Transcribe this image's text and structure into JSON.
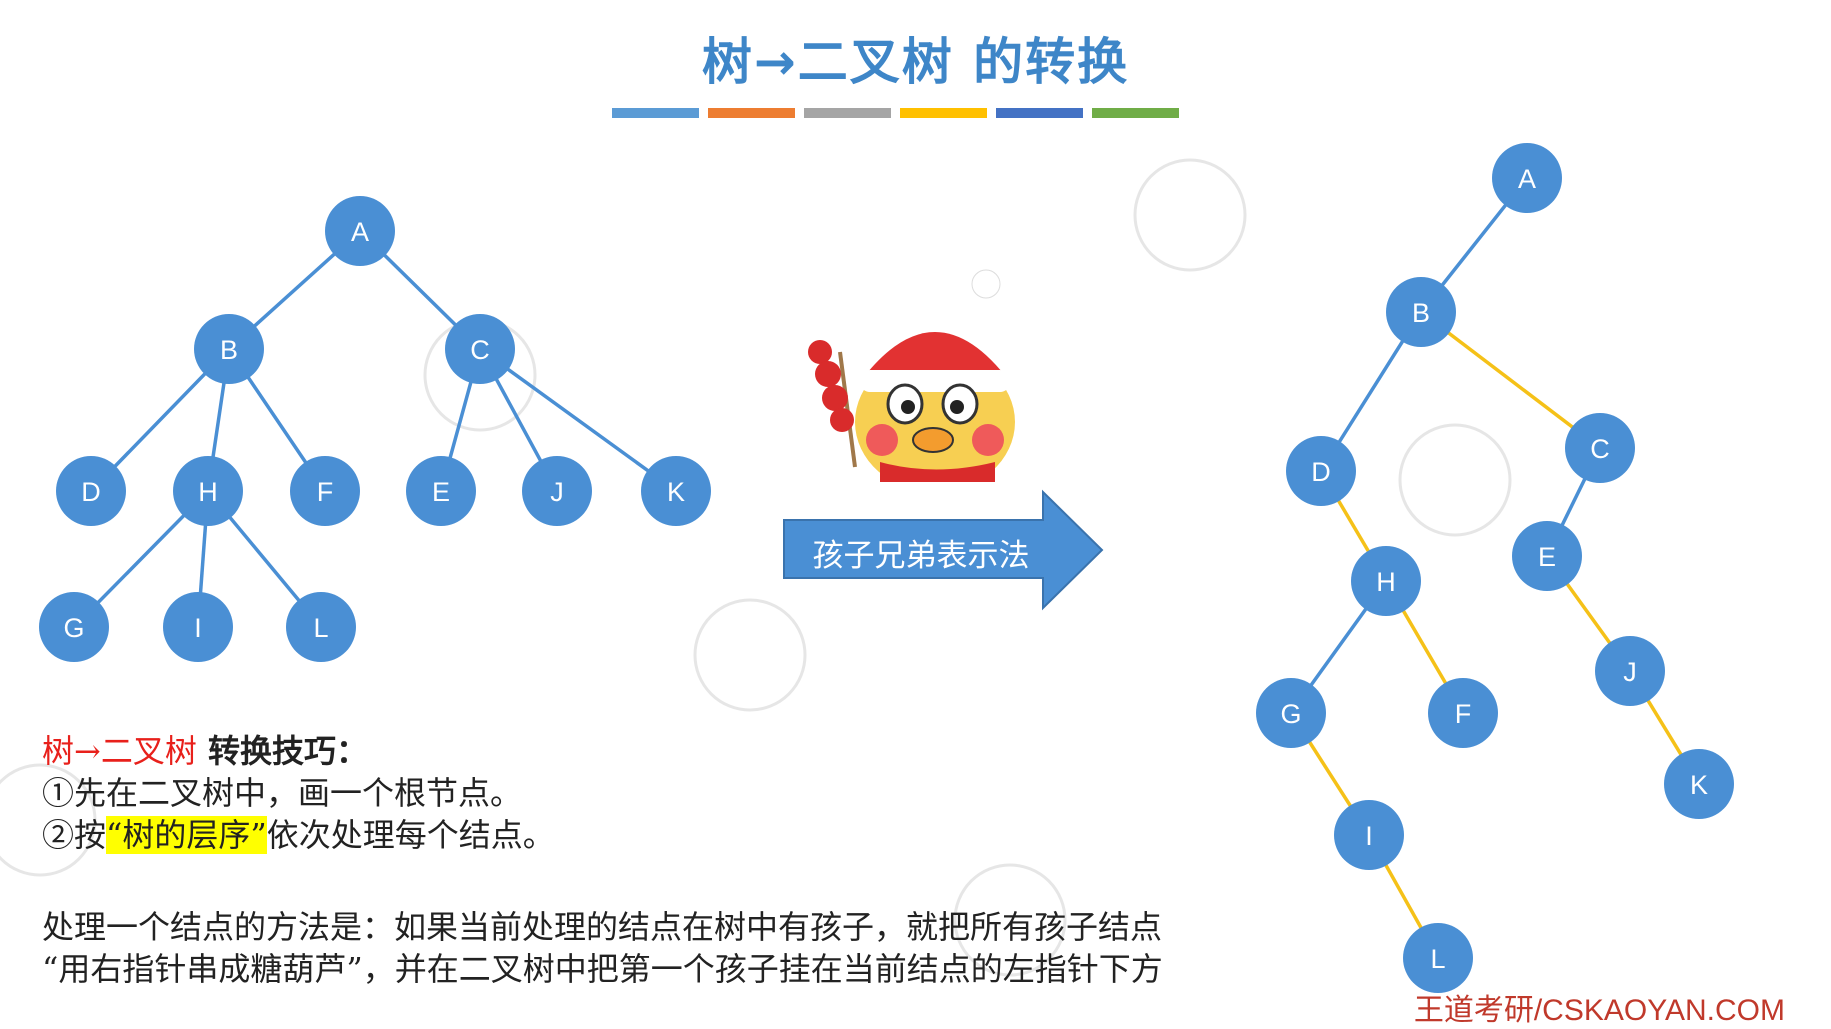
{
  "title": {
    "part1": "树",
    "arrow": "→",
    "part2": "二叉树 的转换"
  },
  "color_bars": [
    "#5b9bd5",
    "#ed7d31",
    "#a5a5a5",
    "#ffc000",
    "#4472c4",
    "#70ad47"
  ],
  "tree_left": {
    "nodes": [
      "A",
      "B",
      "C",
      "D",
      "H",
      "F",
      "E",
      "J",
      "K",
      "G",
      "I",
      "L"
    ]
  },
  "arrow": {
    "label": "孩子兄弟表示法"
  },
  "tree_right": {
    "nodes": [
      "A",
      "B",
      "C",
      "D",
      "E",
      "H",
      "J",
      "G",
      "F",
      "K",
      "I",
      "L"
    ]
  },
  "tips": {
    "heading_red": "树→二叉树",
    "heading_rest": " 转换技巧：",
    "step1": "①先在二叉树中，画一个根节点。",
    "step2_prefix": "②按",
    "step2_highlight": "“树的层序”",
    "step2_suffix": "依次处理每个结点。"
  },
  "method": {
    "line1": "处理一个结点的方法是：如果当前处理的结点在树中有孩子，就把所有孩子结点",
    "line2": "“用右指针串成糖葫芦”，并在二叉树中把第一个孩子挂在当前结点的左指针下方"
  },
  "footer": "王道考研/CSKAOYAN.COM"
}
